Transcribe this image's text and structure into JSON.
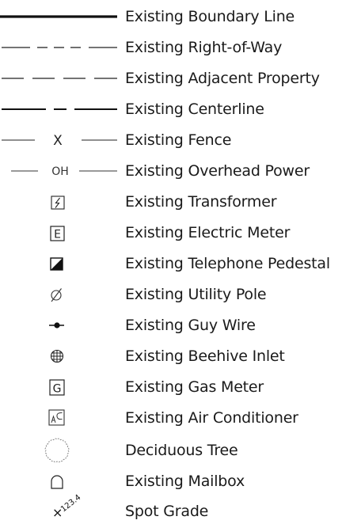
{
  "legend": {
    "items": [
      {
        "symbol": "boundary-line",
        "label": "Existing Boundary Line"
      },
      {
        "symbol": "right-of-way-line",
        "label": "Existing Right-of-Way"
      },
      {
        "symbol": "adjacent-property-line",
        "label": "Existing Adjacent Property"
      },
      {
        "symbol": "centerline",
        "label": "Existing Centerline"
      },
      {
        "symbol": "fence-line",
        "label": "Existing Fence",
        "symbol_text": "X"
      },
      {
        "symbol": "overhead-power-line",
        "label": "Existing Overhead Power",
        "symbol_text": "OH"
      },
      {
        "symbol": "transformer-icon",
        "label": "Existing Transformer"
      },
      {
        "symbol": "electric-meter-icon",
        "label": "Existing Electric Meter",
        "symbol_text": "E"
      },
      {
        "symbol": "telephone-pedestal-icon",
        "label": "Existing Telephone Pedestal"
      },
      {
        "symbol": "utility-pole-icon",
        "label": "Existing Utility Pole"
      },
      {
        "symbol": "guy-wire-icon",
        "label": "Existing Guy Wire"
      },
      {
        "symbol": "beehive-inlet-icon",
        "label": "Existing Beehive Inlet"
      },
      {
        "symbol": "gas-meter-icon",
        "label": "Existing Gas Meter",
        "symbol_text": "G"
      },
      {
        "symbol": "air-conditioner-icon",
        "label": "Existing Air Conditioner"
      },
      {
        "symbol": "deciduous-tree-icon",
        "label": "Deciduous Tree"
      },
      {
        "symbol": "mailbox-icon",
        "label": "Existing Mailbox"
      },
      {
        "symbol": "spot-grade-icon",
        "label": "Spot Grade",
        "symbol_text": "123.4"
      }
    ]
  }
}
